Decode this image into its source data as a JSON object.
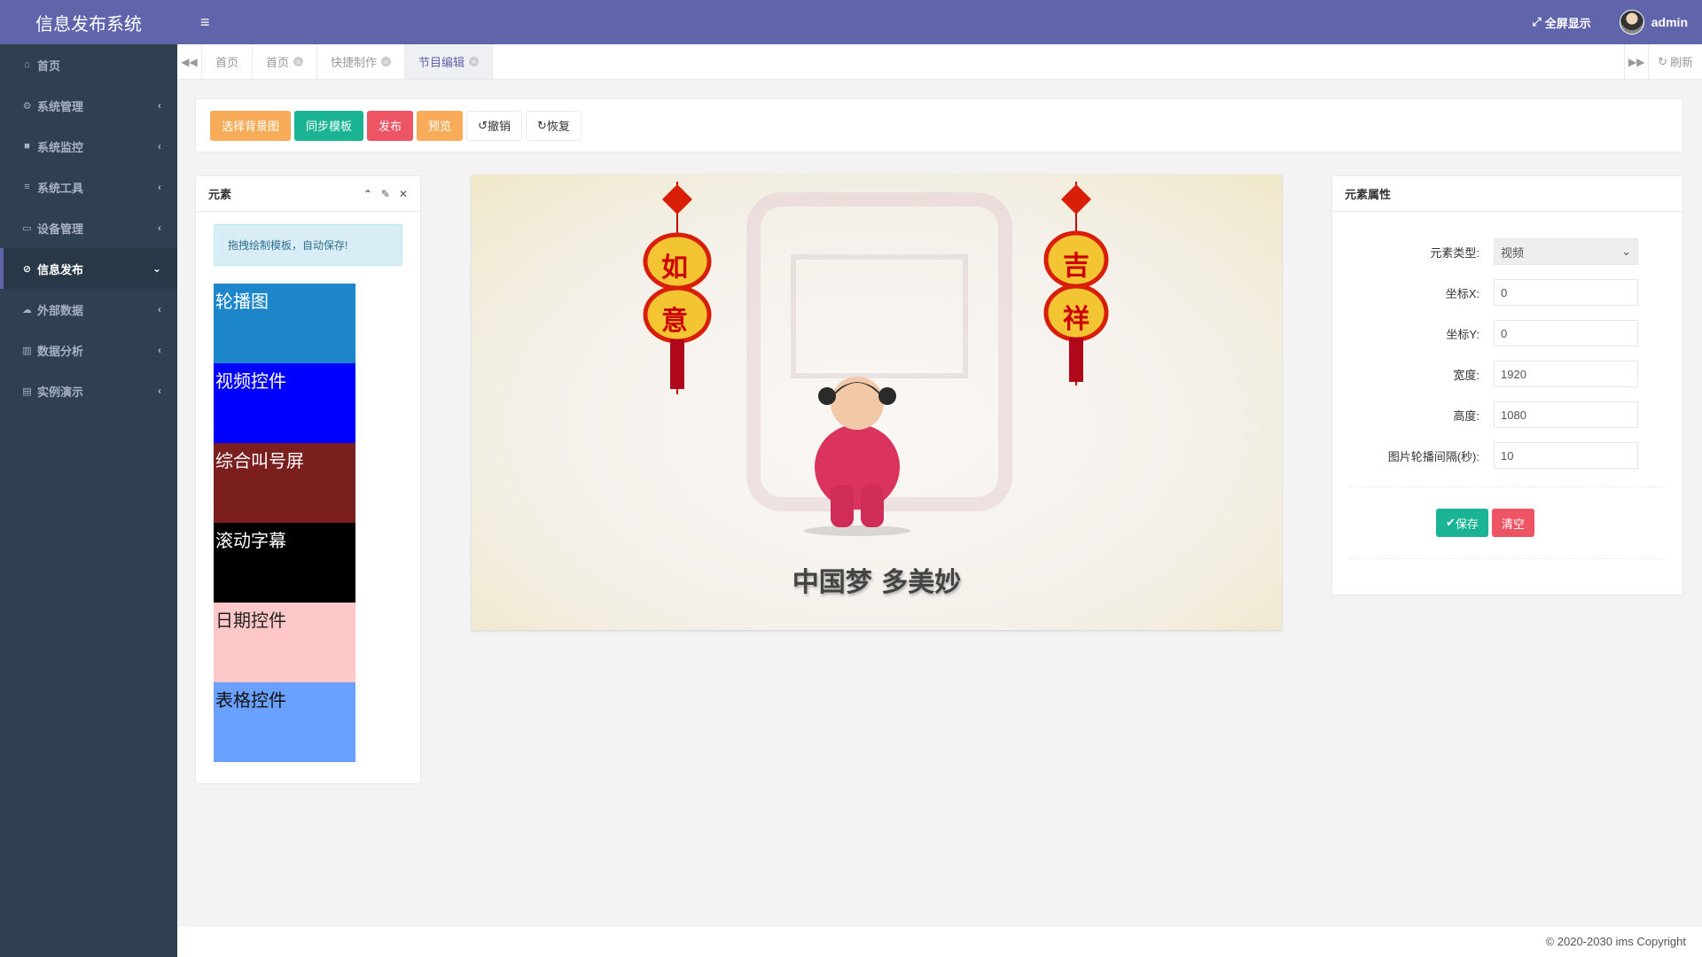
{
  "app": {
    "title": "信息发布系统"
  },
  "sidebar": {
    "items": [
      {
        "icon": "home-icon",
        "glyph": "⌂",
        "label": "首页",
        "has_arrow": false
      },
      {
        "icon": "gear-icon",
        "glyph": "⚙",
        "label": "系统管理",
        "has_arrow": true
      },
      {
        "icon": "video-camera-icon",
        "glyph": "■",
        "label": "系统监控",
        "has_arrow": true
      },
      {
        "icon": "bars-icon",
        "glyph": "≡",
        "label": "系统工具",
        "has_arrow": true
      },
      {
        "icon": "desktop-icon",
        "glyph": "▭",
        "label": "设备管理",
        "has_arrow": true
      },
      {
        "icon": "compass-icon",
        "glyph": "⊘",
        "label": "信息发布",
        "has_arrow": true,
        "active": true
      },
      {
        "icon": "cloud-icon",
        "glyph": "☁",
        "label": "外部数据",
        "has_arrow": true
      },
      {
        "icon": "bar-chart-icon",
        "glyph": "▥",
        "label": "数据分析",
        "has_arrow": true
      },
      {
        "icon": "book-icon",
        "glyph": "▤",
        "label": "实例演示",
        "has_arrow": true
      }
    ]
  },
  "header": {
    "fullscreen_label": "全屏显示",
    "user_name": "admin"
  },
  "tabs": {
    "items": [
      {
        "label": "首页",
        "closable": false
      },
      {
        "label": "首页",
        "closable": true
      },
      {
        "label": "快捷制作",
        "closable": true
      },
      {
        "label": "节目编辑",
        "closable": true,
        "active": true
      }
    ],
    "refresh_label": "刷新"
  },
  "toolbar": {
    "select_bg_label": "选择背景图",
    "sync_template_label": "同步模板",
    "publish_label": "发布",
    "preview_label": "预览",
    "undo_label": "撤销",
    "redo_label": "恢复"
  },
  "elements_panel": {
    "title": "元素",
    "tip": "拖拽绘制模板，自动保存!",
    "widgets": [
      {
        "label": "轮播图",
        "bg": "#1e87cc",
        "color": "#ffffff"
      },
      {
        "label": "视频控件",
        "bg": "#0000ff",
        "color": "#ffffff"
      },
      {
        "label": "综合叫号屏",
        "bg": "#7a1e1e",
        "color": "#ffffff"
      },
      {
        "label": "滚动字幕",
        "bg": "#000000",
        "color": "#ffffff"
      },
      {
        "label": "日期控件",
        "bg": "#ffc8c8",
        "color": "#222222"
      },
      {
        "label": "表格控件",
        "bg": "#6aa0ff",
        "color": "#111111"
      }
    ]
  },
  "canvas": {
    "slogan": "中国梦 多美妙",
    "lantern_left_text": [
      "如",
      "意"
    ],
    "lantern_right_text": [
      "吉",
      "祥"
    ]
  },
  "props_panel": {
    "title": "元素属性",
    "fields": [
      {
        "label": "元素类型:",
        "value": "视频",
        "type": "select"
      },
      {
        "label": "坐标X:",
        "value": "0",
        "type": "input"
      },
      {
        "label": "坐标Y:",
        "value": "0",
        "type": "input"
      },
      {
        "label": "宽度:",
        "value": "1920",
        "type": "input"
      },
      {
        "label": "高度:",
        "value": "1080",
        "type": "input"
      },
      {
        "label": "图片轮播间隔(秒):",
        "value": "10",
        "type": "input"
      }
    ],
    "save_label": "保存",
    "clear_label": "清空"
  },
  "footer": {
    "copyright": "© 2020-2030 ims Copyright"
  },
  "colors": {
    "brand": "#6064ab",
    "sidebar_bg": "#2f4050",
    "green": "#1ab394",
    "orange": "#f8ac59",
    "red": "#ed5565"
  }
}
